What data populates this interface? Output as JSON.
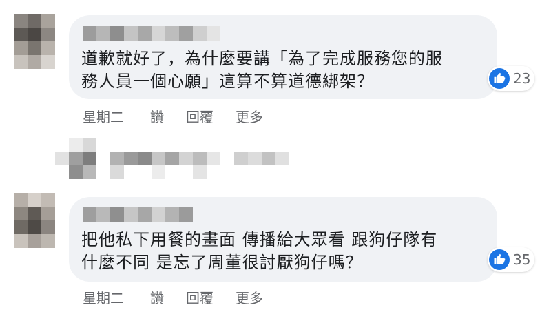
{
  "comments": [
    {
      "text_line1": "道歉就好了，為什麼要講「為了完成服務您的服",
      "text_line2": "務人員一個心願」這算不算道德綁架？",
      "reaction_count": "23",
      "actions": {
        "time": "星期二",
        "like": "讚",
        "reply": "回覆",
        "more": "更多"
      }
    },
    {
      "text_line1": "把他私下用餐的畫面 傳播給大眾看 跟狗仔隊有",
      "text_line2": "什麼不同 是忘了周董很討厭狗仔嗎？",
      "reaction_count": "35",
      "actions": {
        "time": "星期二",
        "like": "讚",
        "reply": "回覆",
        "more": "更多"
      }
    }
  ],
  "icons": {
    "reaction": "thumbs-up-icon"
  },
  "colors": {
    "like_blue": "#1b74e4",
    "bubble_bg": "#f0f2f5",
    "meta_gray": "#65676b"
  }
}
